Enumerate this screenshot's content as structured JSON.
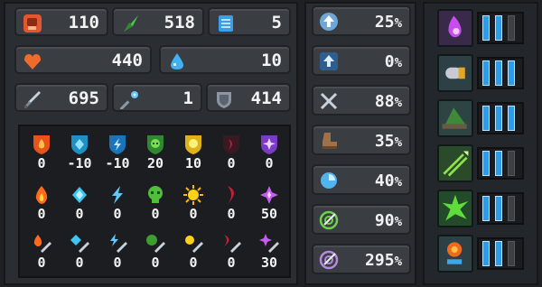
{
  "colors": {
    "panel": "#2a2d31",
    "box": "#3a3d42",
    "text": "#f4f4f4",
    "bar_on": "#2e9de8"
  },
  "stats": {
    "strength": {
      "icon": "fist-icon",
      "value": "110"
    },
    "agility": {
      "icon": "feather-icon",
      "value": "518"
    },
    "intellect": {
      "icon": "book-icon",
      "value": "5"
    },
    "health": {
      "icon": "heart-icon",
      "value": "440"
    },
    "mana": {
      "icon": "water-drop-icon",
      "value": "10"
    },
    "attack": {
      "icon": "sword-icon",
      "value": "695"
    },
    "magic": {
      "icon": "wand-icon",
      "value": "1"
    },
    "defense": {
      "icon": "shield-icon",
      "value": "414"
    }
  },
  "resistances": {
    "rows": [
      {
        "kind": "shield",
        "values": [
          "0",
          "-10",
          "-10",
          "20",
          "10",
          "0",
          "0"
        ]
      },
      {
        "kind": "element",
        "values": [
          "0",
          "0",
          "0",
          "0",
          "0",
          "0",
          "50"
        ]
      },
      {
        "kind": "weapon",
        "values": [
          "0",
          "0",
          "0",
          "0",
          "0",
          "0",
          "30"
        ]
      }
    ],
    "elements": [
      "fire",
      "ice",
      "lightning",
      "poison",
      "holy",
      "dark",
      "arcane"
    ]
  },
  "percentages": [
    {
      "icon": "arrow-up-icon",
      "value": "25",
      "unit": "%"
    },
    {
      "icon": "arrow-up-icon",
      "value": "0",
      "unit": "%"
    },
    {
      "icon": "crossed-swords-icon",
      "value": "88",
      "unit": "%"
    },
    {
      "icon": "boot-icon",
      "value": "35",
      "unit": "%"
    },
    {
      "icon": "clock-icon",
      "value": "40",
      "unit": "%"
    },
    {
      "icon": "target-icon",
      "value": "90",
      "unit": "%"
    },
    {
      "icon": "spiral-target-icon",
      "value": "295",
      "unit": "%"
    }
  ],
  "slots": [
    {
      "icon": "purple-orb-icon",
      "level": 2,
      "max": 3
    },
    {
      "icon": "bullet-icon",
      "level": 3,
      "max": 3
    },
    {
      "icon": "green-hat-icon",
      "level": 3,
      "max": 3
    },
    {
      "icon": "arrows-icon",
      "level": 2,
      "max": 3
    },
    {
      "icon": "green-splash-icon",
      "level": 2,
      "max": 3
    },
    {
      "icon": "orange-potion-icon",
      "level": 2,
      "max": 3
    }
  ]
}
